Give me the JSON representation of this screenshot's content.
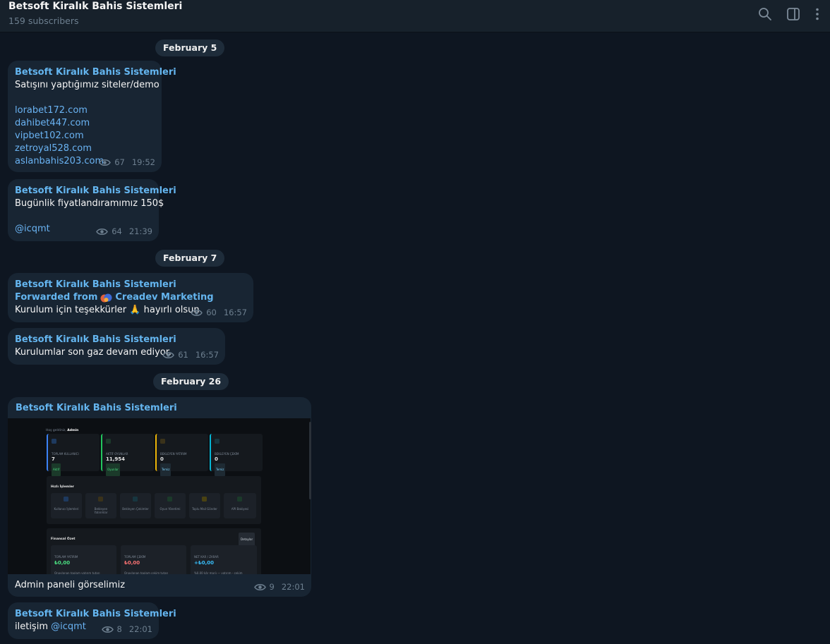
{
  "header": {
    "title": "Betsoft Kiralık Bahis Sistemleri",
    "subscribers": "159 subscribers",
    "icons": [
      "search-icon",
      "sidebar-toggle-icon",
      "more-vertical-icon"
    ]
  },
  "dates": {
    "d1": "February 5",
    "d2": "February 7",
    "d3": "February 26"
  },
  "messages": [
    {
      "sender": "Betsoft Kiralık Bahis Sistemleri",
      "text": "Satışını yaptığımız siteler/demo",
      "links": [
        "lorabet172.com",
        "dahibet447.com",
        "vipbet102.com",
        "zetroyal528.com",
        "aslanbahis203.com"
      ],
      "views": "67",
      "time": "19:52"
    },
    {
      "sender": "Betsoft Kiralık Bahis Sistemleri",
      "text": "Bugünlik fiyatlandıramımız 150$",
      "mention": "@icqmt",
      "views": "64",
      "time": "21:39"
    },
    {
      "sender": "Betsoft Kiralık Bahis Sistemleri",
      "forward_prefix": "Forwarded from",
      "forward_from": "Creadev Marketing",
      "text_before": "Kurulum için teşekkürler",
      "emoji": "🙏",
      "text_after": "hayırlı olsun",
      "views": "60",
      "time": "16:57"
    },
    {
      "sender": "Betsoft Kiralık Bahis Sistemleri",
      "text": "Kurulumlar son gaz devam ediyor.",
      "views": "61",
      "time": "16:57"
    },
    {
      "sender": "Betsoft Kiralık Bahis Sistemleri",
      "caption": "Admin paneli görselimiz",
      "views": "9",
      "time": "22:01",
      "image": {
        "welcome": "Hoş geldiniz,",
        "welcome_name": "Admin",
        "stats": [
          {
            "label": "TOPLAM KULLANICI",
            "value": "7",
            "badge": "Aktif",
            "color": "#3b82f6"
          },
          {
            "label": "AKTİF OYUNLAR",
            "value": "11,954",
            "badge": "Oyunlar",
            "color": "#22c55e"
          },
          {
            "label": "BEKLEYEN YATIRIM",
            "value": "0",
            "badge": "Temiz",
            "color": "#eab308"
          },
          {
            "label": "BEKLEYEN ÇEKİM",
            "value": "0",
            "badge": "Temiz",
            "color": "#06b6d4"
          }
        ],
        "quick_title": "Hızlı İşlemler",
        "quick_items": [
          "Kullanıcı İşlemleri",
          "Bekleyen Yatırımlar",
          "Bekleyen Çekimler",
          "Oyun Yönetimi",
          "Toplu Mail Gönder",
          "API Bakiyesi"
        ],
        "finance_title": "Finansal Özet",
        "finance_button": "Detaylar",
        "finance_cards": [
          {
            "label": "TOPLAM YATIRIM",
            "value": "₺0,00",
            "note": "Onaylanan toplam yatırım tutarı"
          },
          {
            "label": "TOPLAM ÇEKİM",
            "value": "₺0,00",
            "note": "Onaylanan toplam çekim tutarı"
          },
          {
            "label": "NET KAR / ZARAR",
            "value": "+₺0,00",
            "note": "%0,00 kâr marjı — yatırım - çekim"
          }
        ]
      }
    },
    {
      "sender": "Betsoft Kiralık Bahis Sistemleri",
      "text": "iletişim",
      "mention": "@icqmt",
      "views": "8",
      "time": "22:01"
    }
  ]
}
